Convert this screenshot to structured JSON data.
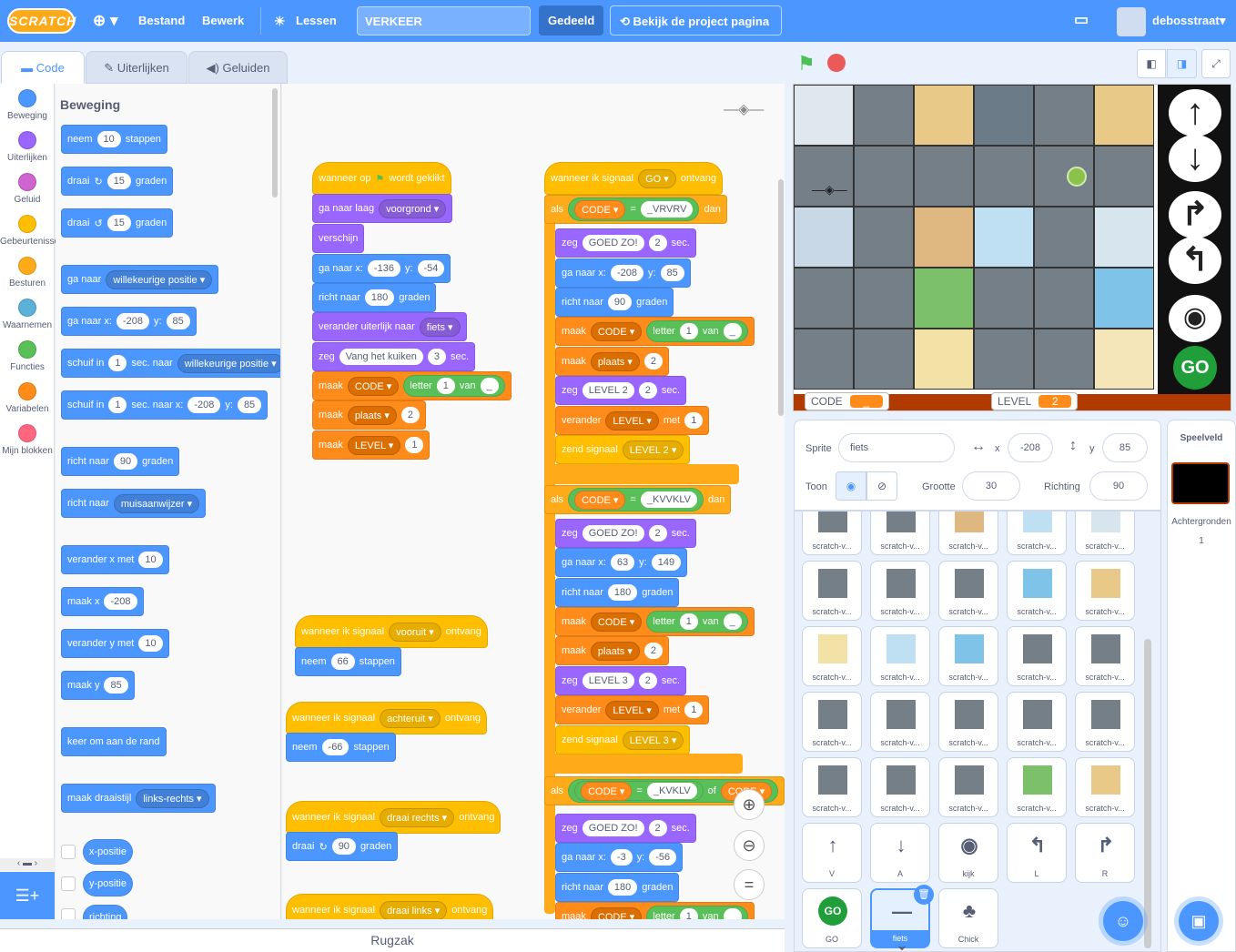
{
  "menu": {
    "logo": "SCRATCH",
    "file": "Bestand",
    "edit": "Bewerk",
    "tutorials": "Lessen",
    "project_title": "VERKEER",
    "share": "Gedeeld",
    "see_project": "Bekijk de project pagina",
    "username": "debosstraat"
  },
  "tabs": {
    "code": "Code",
    "costumes": "Uiterlijken",
    "sounds": "Geluiden"
  },
  "categories": [
    "Beweging",
    "Uiterlijken",
    "Geluid",
    "Gebeurtenissen",
    "Besturen",
    "Waarnemen",
    "Functies",
    "Variabelen",
    "Mijn blokken"
  ],
  "category_colors": [
    "#4c97ff",
    "#9966ff",
    "#cf63cf",
    "#ffbf00",
    "#ffab19",
    "#5cb1d6",
    "#59c059",
    "#ff8c1a",
    "#ff6680"
  ],
  "palette": {
    "heading": "Beweging",
    "move": {
      "a": "neem",
      "n": "10",
      "b": "stappen"
    },
    "turn_right": {
      "a": "draai",
      "n": "15",
      "b": "graden"
    },
    "turn_left": {
      "a": "draai",
      "n": "15",
      "b": "graden"
    },
    "goto": {
      "a": "ga naar",
      "d": "willekeurige positie"
    },
    "gotoxy": {
      "a": "ga naar x:",
      "x": "-208",
      "y_lbl": "y:",
      "y": "85"
    },
    "glide": {
      "a": "schuif in",
      "n": "1",
      "b": "sec. naar",
      "d": "willekeurige positie"
    },
    "glidexy": {
      "a": "schuif in",
      "n": "1",
      "b": "sec. naar x:",
      "x": "-208",
      "y_lbl": "y:",
      "y": "85"
    },
    "point": {
      "a": "richt naar",
      "n": "90",
      "b": "graden"
    },
    "pointto": {
      "a": "richt naar",
      "d": "muisaanwijzer"
    },
    "changex": {
      "a": "verander x met",
      "n": "10"
    },
    "setx": {
      "a": "maak x",
      "n": "-208"
    },
    "changey": {
      "a": "verander y met",
      "n": "10"
    },
    "sety": {
      "a": "maak y",
      "n": "85"
    },
    "bounce": "keer om aan de rand",
    "rotstyle": {
      "a": "maak draaistijl",
      "d": "links-rechts"
    },
    "xpos": "x-positie",
    "ypos": "y-positie",
    "dir": "richting"
  },
  "ws": {
    "s1": {
      "hat_a": "wanneer op",
      "hat_b": "wordt geklikt",
      "layer": "ga naar laag",
      "layer_d": "voorgrond",
      "show": "verschijn",
      "gotoxy": "ga naar x:",
      "x": "-136",
      "yl": "y:",
      "y": "-54",
      "point": "richt naar",
      "pn": "180",
      "pb": "graden",
      "costume": "verander uiterlijk naar",
      "costume_d": "fiets",
      "say": "zeg",
      "say_t": "Vang het kuiken",
      "say_n": "3",
      "say_s": "sec.",
      "set": "maak",
      "v_code": "CODE",
      "to": "letter",
      "ln": "1",
      "van": "van",
      "blank": "_",
      "v_plaats": "plaats",
      "n2": "2",
      "v_level": "LEVEL",
      "n1": "1"
    },
    "s2": {
      "hat": "wanneer ik signaal",
      "msg": "vooruit",
      "ontv": "ontvang",
      "move": "neem",
      "n": "66",
      "b": "stappen"
    },
    "s3": {
      "hat": "wanneer ik signaal",
      "msg": "achteruit",
      "ontv": "ontvang",
      "move": "neem",
      "n": "-66",
      "b": "stappen"
    },
    "s4": {
      "hat": "wanneer ik signaal",
      "msg": "draai rechts",
      "ontv": "ontvang",
      "turn": "draai",
      "n": "90",
      "b": "graden"
    },
    "s5": {
      "hat": "wanneer ik signaal",
      "msg": "draai links",
      "ontv": "ontvang"
    },
    "s6": {
      "hat": "wanneer ik signaal",
      "msg": "GO",
      "ontv": "ontvang",
      "if": "als",
      "then": "dan",
      "code": "CODE",
      "eq": "=",
      "c1": "_VRVRV",
      "c2": "_KVVKLV",
      "c3": "_KVKLV",
      "or": "of",
      "c3b": "CODE",
      "say": "zeg",
      "goed": "GOED ZO!",
      "n2": "2",
      "sec": "sec.",
      "gotoxy": "ga naar x:",
      "yl": "y:",
      "x1": "-208",
      "y1": "85",
      "x2": "63",
      "y2": "149",
      "x3": "-3",
      "y3": "-56",
      "point": "richt naar",
      "p1": "90",
      "p2": "180",
      "p3": "180",
      "graden": "graden",
      "set": "maak",
      "letter": "letter",
      "one": "1",
      "van": "van",
      "blank": "_",
      "plaats": "plaats",
      "lvl2": "LEVEL 2",
      "lvl3": "LEVEL 3",
      "change": "verander",
      "level": "LEVEL",
      "met": "met",
      "bcast": "zend signaal"
    }
  },
  "stage": {
    "monitor_code_label": "CODE",
    "monitor_code_value": "_",
    "monitor_level_label": "LEVEL",
    "monitor_level_value": "2",
    "go": "GO"
  },
  "sprite_info": {
    "sprite_label": "Sprite",
    "sprite_name": "fiets",
    "x_label": "x",
    "x": "-208",
    "y_label": "y",
    "y": "85",
    "show_label": "Toon",
    "size_label": "Grootte",
    "size": "30",
    "dir_label": "Richting",
    "dir": "90"
  },
  "sprites": [
    "scratch-v...",
    "scratch-v...",
    "scratch-v...",
    "scratch-v...",
    "scratch-v...",
    "scratch-v...",
    "scratch-v...",
    "scratch-v...",
    "scratch-v...",
    "scratch-v...",
    "scratch-v...",
    "scratch-v...",
    "scratch-v...",
    "scratch-v...",
    "scratch-v...",
    "scratch-v...",
    "scratch-v...",
    "scratch-v...",
    "scratch-v...",
    "scratch-v...",
    "scratch-v...",
    "scratch-v...",
    "scratch-v...",
    "scratch-v...",
    "scratch-v...",
    "V",
    "A",
    "kijk",
    "L",
    "R",
    "GO",
    "fiets",
    "Chick"
  ],
  "stage_pane": {
    "title": "Speelveld",
    "backdrops_label": "Achtergronden",
    "backdrops_count": "1"
  },
  "backpack": "Rugzak"
}
